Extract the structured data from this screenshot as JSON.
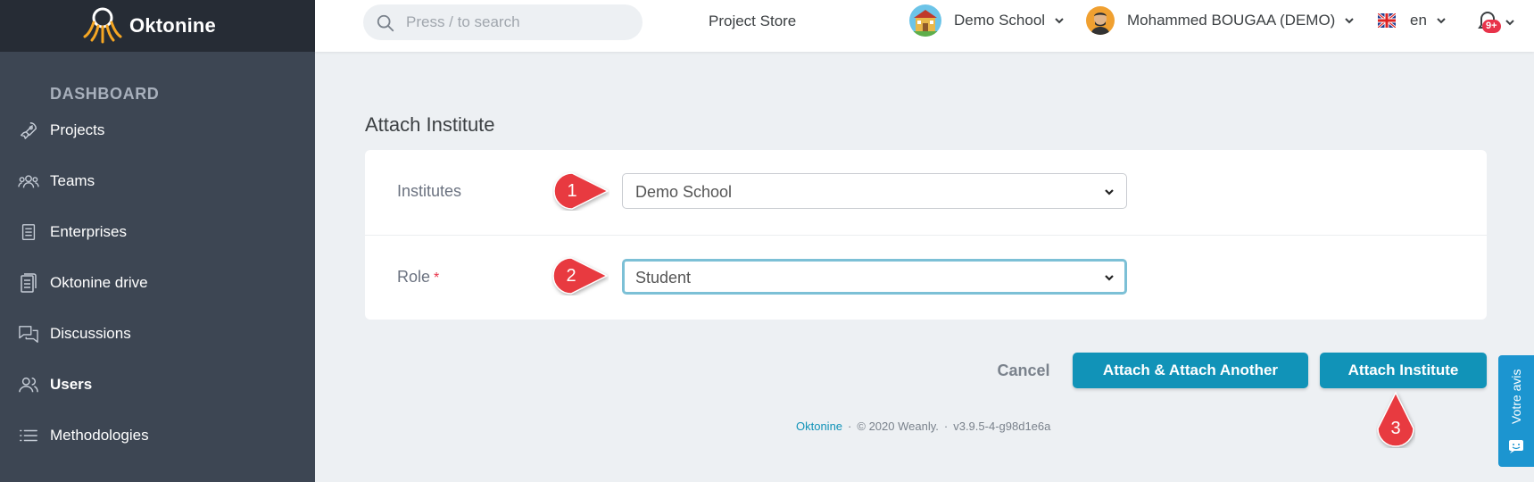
{
  "app": {
    "brand_name": "Oktonine",
    "brand_color": "#f5a623",
    "accent_color": "#1193b8"
  },
  "topbar": {
    "search": {
      "placeholder": "Press / to search",
      "value": ""
    },
    "project_store_label": "Project Store",
    "school_label": "Demo School",
    "user_label": "Mohammed BOUGAA (DEMO)",
    "lang_label": "en",
    "notification_badge": "9+"
  },
  "sidebar": {
    "section_title": "DASHBOARD",
    "items": [
      {
        "label": "Projects",
        "icon": "rocket-icon",
        "active": false
      },
      {
        "label": "Teams",
        "icon": "team-icon",
        "active": false
      },
      {
        "label": "Enterprises",
        "icon": "building-icon",
        "active": false
      },
      {
        "label": "Oktonine drive",
        "icon": "document-icon",
        "active": false
      },
      {
        "label": "Discussions",
        "icon": "chat-icon",
        "active": false
      },
      {
        "label": "Users",
        "icon": "users-icon",
        "active": true
      },
      {
        "label": "Methodologies",
        "icon": "list-icon",
        "active": false
      }
    ]
  },
  "main": {
    "title": "Attach Institute",
    "form": {
      "institutes_label": "Institutes",
      "institutes_value": "Demo School",
      "role_label": "Role",
      "role_required_mark": "*",
      "role_value": "Student"
    },
    "markers": [
      "1",
      "2",
      "3"
    ],
    "buttons": {
      "cancel": "Cancel",
      "attach_another": "Attach & Attach Another",
      "attach": "Attach Institute"
    }
  },
  "footer": {
    "brand": "Oktonine",
    "copyright": "© 2020 Weanly.",
    "version": "v3.9.5-4-g98d1e6a"
  },
  "feedback": {
    "label": "Votre avis"
  }
}
